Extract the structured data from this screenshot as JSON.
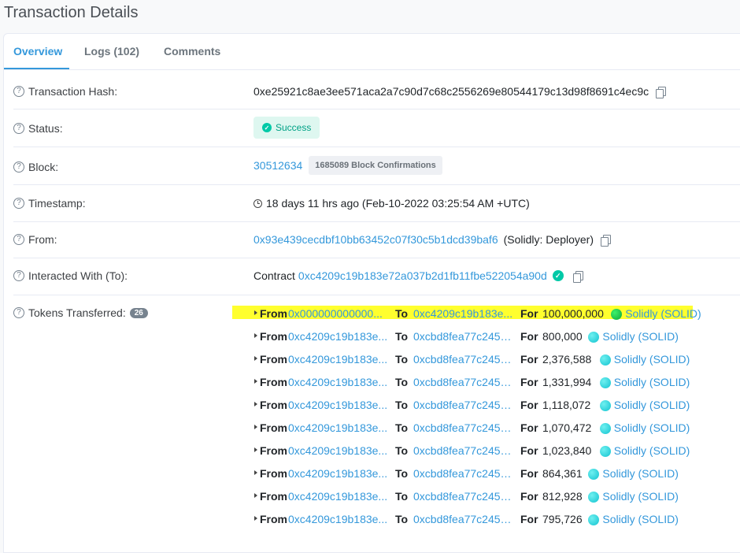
{
  "page": {
    "title": "Transaction Details"
  },
  "tabs": [
    {
      "label": "Overview",
      "active": true
    },
    {
      "label": "Logs (102)",
      "active": false
    },
    {
      "label": "Comments",
      "active": false
    }
  ],
  "fields": {
    "hash": {
      "label": "Transaction Hash:",
      "value": "0xe25921c8ae3ee571aca2a7c90d7c68c2556269e80544179c13d98f8691c4ec9c"
    },
    "status": {
      "label": "Status:",
      "value": "Success"
    },
    "block": {
      "label": "Block:",
      "value": "30512634",
      "confirmations": "1685089 Block Confirmations"
    },
    "timestamp": {
      "label": "Timestamp:",
      "value": "18 days 11 hrs ago (Feb-10-2022 03:25:54 AM +UTC)"
    },
    "from": {
      "label": "From:",
      "address": "0x93e439cecdbf10bb63452c07f30c5b1dcd39baf6",
      "tag": "(Solidly: Deployer)"
    },
    "to": {
      "label": "Interacted With (To):",
      "prefix": "Contract",
      "address": "0xc4209c19b183e72a037b2d1fb11fbe522054a90d"
    },
    "tokens": {
      "label": "Tokens Transferred:",
      "count": "26"
    }
  },
  "transfer_labels": {
    "from": "From",
    "to": "To",
    "for": "For"
  },
  "transfers": [
    {
      "from": "0x000000000000...",
      "to": "0xc4209c19b183e...",
      "amount": "100,000,000",
      "token": "Solidly (SOLID)",
      "highlight": true
    },
    {
      "from": "0xc4209c19b183e...",
      "to": "0xcbd8fea77c2452...",
      "amount": "800,000",
      "token": "Solidly (SOLID)"
    },
    {
      "from": "0xc4209c19b183e...",
      "to": "0xcbd8fea77c2452...",
      "amount": "2,376,588",
      "token": "Solidly (SOLID)"
    },
    {
      "from": "0xc4209c19b183e...",
      "to": "0xcbd8fea77c2452...",
      "amount": "1,331,994",
      "token": "Solidly (SOLID)"
    },
    {
      "from": "0xc4209c19b183e...",
      "to": "0xcbd8fea77c2452...",
      "amount": "1,118,072",
      "token": "Solidly (SOLID)"
    },
    {
      "from": "0xc4209c19b183e...",
      "to": "0xcbd8fea77c2452...",
      "amount": "1,070,472",
      "token": "Solidly (SOLID)"
    },
    {
      "from": "0xc4209c19b183e...",
      "to": "0xcbd8fea77c2452...",
      "amount": "1,023,840",
      "token": "Solidly (SOLID)"
    },
    {
      "from": "0xc4209c19b183e...",
      "to": "0xcbd8fea77c2452...",
      "amount": "864,361",
      "token": "Solidly (SOLID)"
    },
    {
      "from": "0xc4209c19b183e...",
      "to": "0xcbd8fea77c2452...",
      "amount": "812,928",
      "token": "Solidly (SOLID)"
    },
    {
      "from": "0xc4209c19b183e...",
      "to": "0xcbd8fea77c2452...",
      "amount": "795,726",
      "token": "Solidly (SOLID)"
    }
  ],
  "colors": {
    "link": "#3498db",
    "highlight": "#ffff2e",
    "success": "#00a186"
  }
}
